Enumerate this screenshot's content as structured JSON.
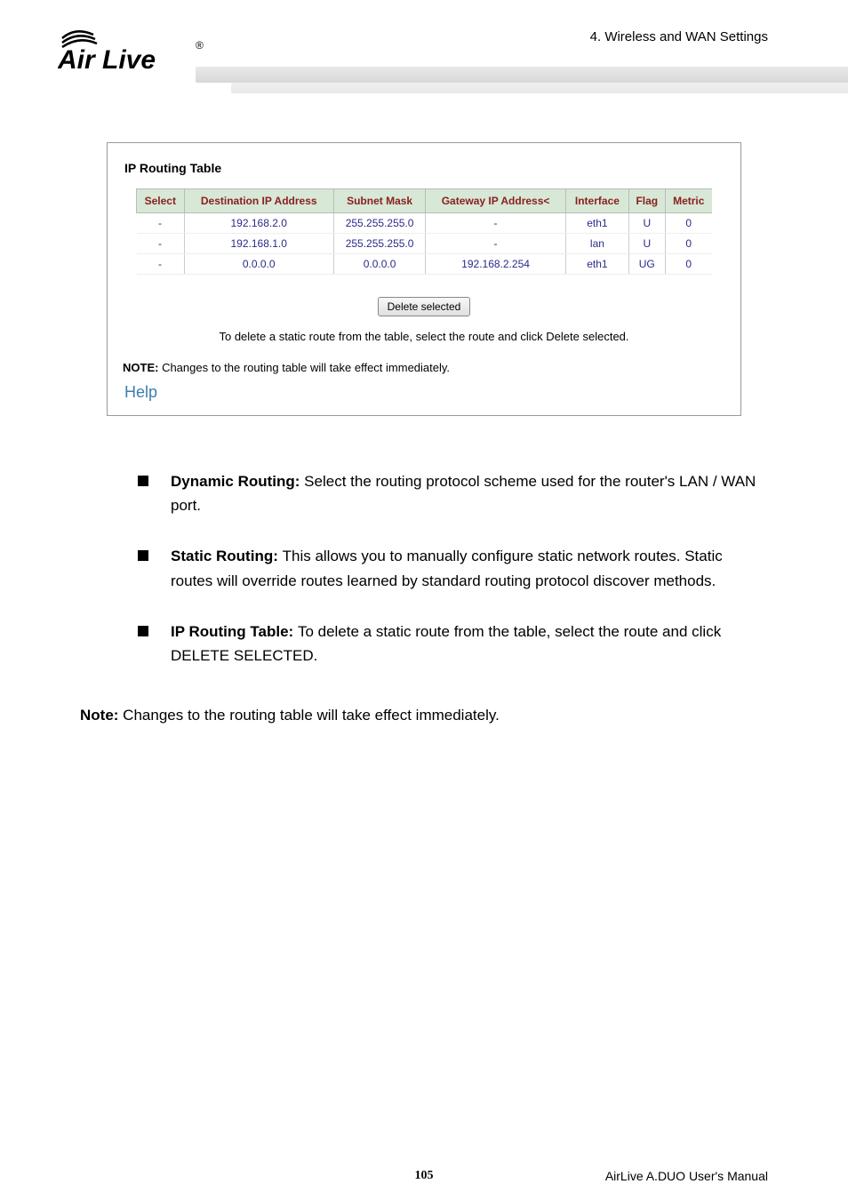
{
  "header": {
    "breadcrumb": "4. Wireless and WAN Settings",
    "logo_main": "Air Live",
    "logo_reg": "®"
  },
  "box": {
    "title": "IP Routing Table",
    "columns": [
      "Select",
      "Destination IP Address",
      "Subnet Mask",
      "Gateway IP Address<",
      "Interface",
      "Flag",
      "Metric"
    ],
    "rows": [
      [
        "-",
        "192.168.2.0",
        "255.255.255.0",
        "-",
        "eth1",
        "U",
        "0"
      ],
      [
        "-",
        "192.168.1.0",
        "255.255.255.0",
        "-",
        "lan",
        "U",
        "0"
      ],
      [
        "-",
        "0.0.0.0",
        "0.0.0.0",
        "192.168.2.254",
        "eth1",
        "UG",
        "0"
      ]
    ],
    "button": "Delete selected",
    "hint": "To delete a static route from the table, select the route and click Delete selected.",
    "note_bold": "NOTE:",
    "note_rest": " Changes to the routing table will take effect immediately.",
    "help": "Help"
  },
  "bullets": [
    {
      "bold": "Dynamic Routing: ",
      "text": "Select the routing protocol scheme used for the router's LAN / WAN port."
    },
    {
      "bold": "Static Routing: ",
      "text": "This allows you to manually configure static network routes. Static routes will override routes learned by standard routing protocol discover methods."
    },
    {
      "bold": "IP Routing Table: ",
      "text": "To delete a static route from the table, select the route and click DELETE SELECTED."
    }
  ],
  "note": {
    "bold": "Note:",
    "text": " Changes to the routing table will take effect immediately."
  },
  "footer": {
    "page": "105",
    "right": "AirLive A.DUO User's Manual"
  }
}
